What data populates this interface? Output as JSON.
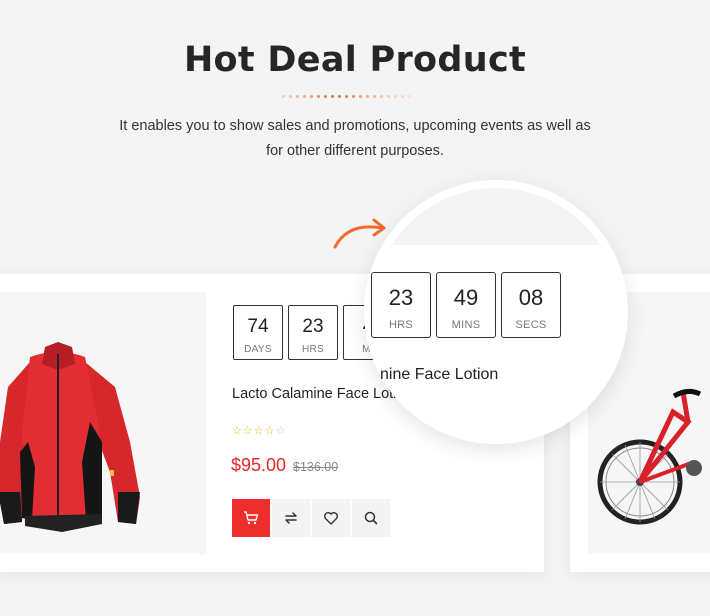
{
  "section": {
    "title": "Hot Deal Product",
    "subtitle_line1": "It enables you to show sales and promotions, upcoming events as well as",
    "subtitle_line2": "for other different purposes."
  },
  "product": {
    "name": "Lacto Calamine Face Lotic",
    "name_zoomed": "nine Face Lotion",
    "price": "$95.00",
    "old_price": "$136.00",
    "rating": 4,
    "max_rating": 5
  },
  "countdown": {
    "days": "74",
    "days_label": "DAYS",
    "hours": "23",
    "hours_label": "HRS",
    "mins_partial": "4",
    "mins_label_partial": "MI"
  },
  "countdown_zoomed": {
    "hours": "23",
    "hours_label": "HRS",
    "mins": "49",
    "mins_label": "MINS",
    "secs": "08",
    "secs_label": "SECS"
  },
  "icons": {
    "cart": "cart-icon",
    "compare": "compare-icon",
    "wishlist": "heart-icon",
    "quickview": "search-icon"
  },
  "colors": {
    "accent": "#ee2d2d",
    "price": "#e8252a",
    "arrow": "#f26a2e",
    "star": "#f5b700"
  }
}
